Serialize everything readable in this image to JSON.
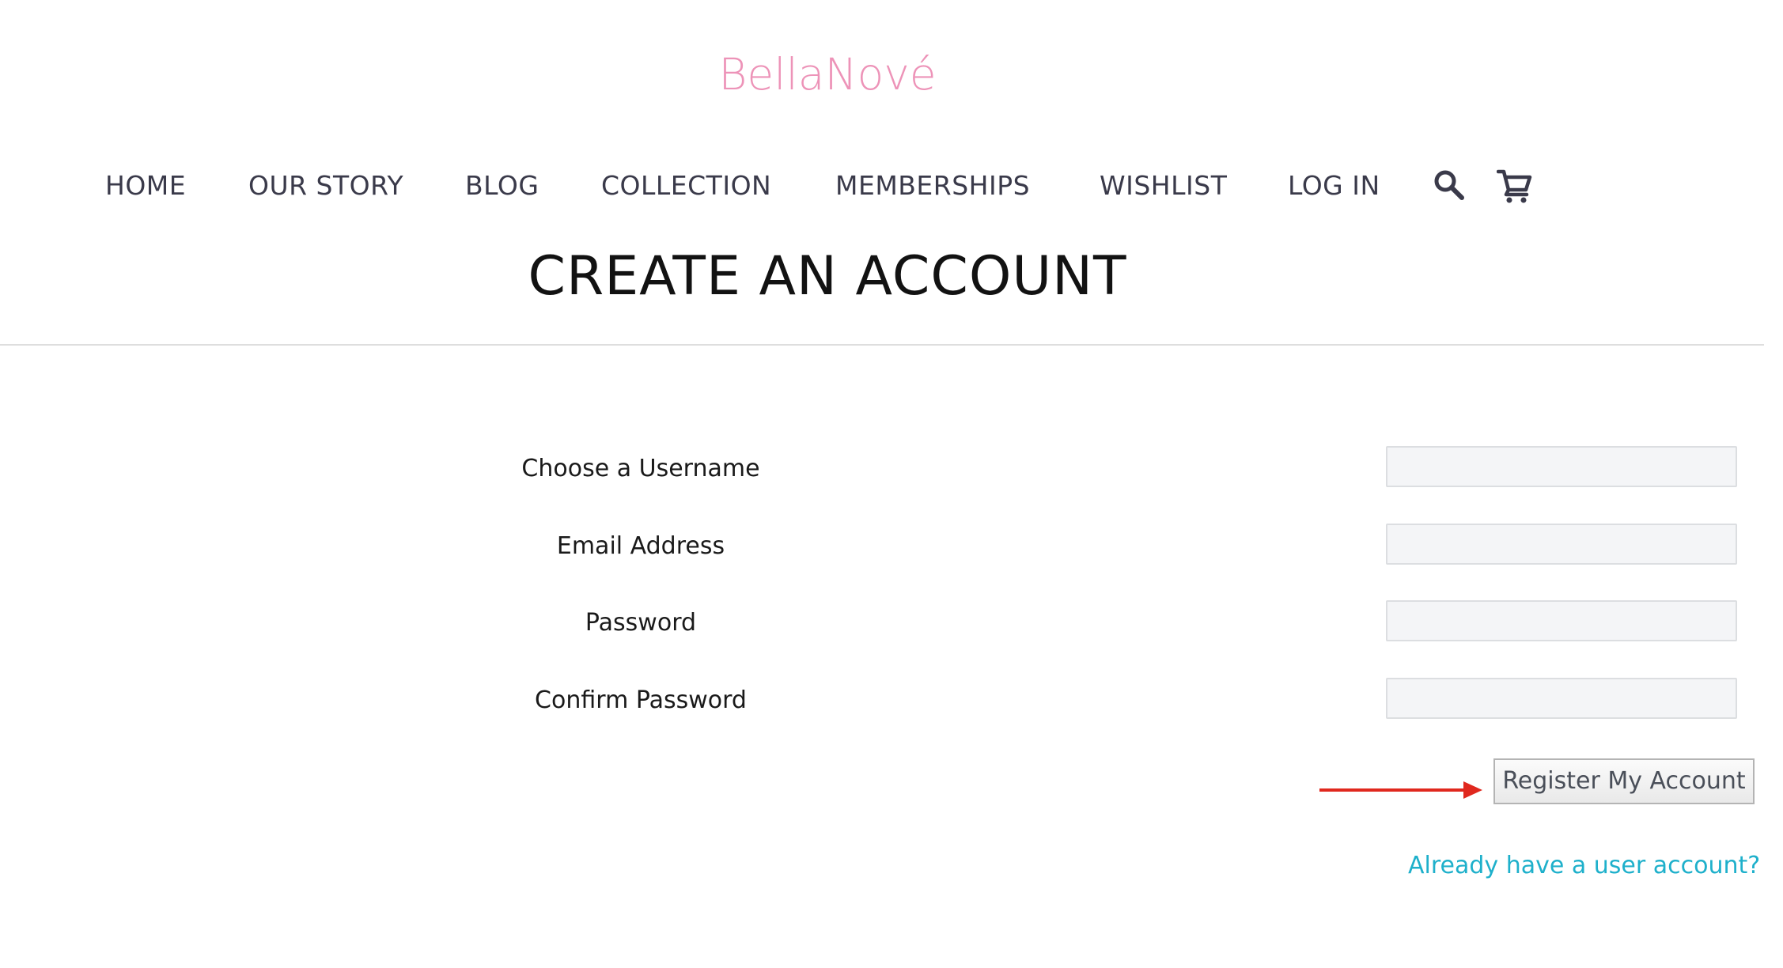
{
  "brand": {
    "logo_text": "BellaNové",
    "logo_color": "#ed93b8"
  },
  "nav": {
    "items": [
      {
        "label": "HOME"
      },
      {
        "label": "OUR STORY"
      },
      {
        "label": "BLOG"
      },
      {
        "label": "COLLECTION"
      },
      {
        "label": "MEMBERSHIPS"
      },
      {
        "label": "WISHLIST"
      },
      {
        "label": "LOG IN"
      }
    ],
    "icons": [
      "search-icon",
      "cart-icon"
    ]
  },
  "page": {
    "title": "CREATE AN ACCOUNT"
  },
  "form": {
    "fields": [
      {
        "label": "Choose a Username",
        "value": ""
      },
      {
        "label": "Email Address",
        "value": ""
      },
      {
        "label": "Password",
        "value": ""
      },
      {
        "label": "Confirm Password",
        "value": ""
      }
    ],
    "submit_label": "Register My Account",
    "login_link": "Already have a user account?"
  },
  "colors": {
    "link": "#1eb0cb",
    "annotation_arrow": "#e0281e"
  }
}
